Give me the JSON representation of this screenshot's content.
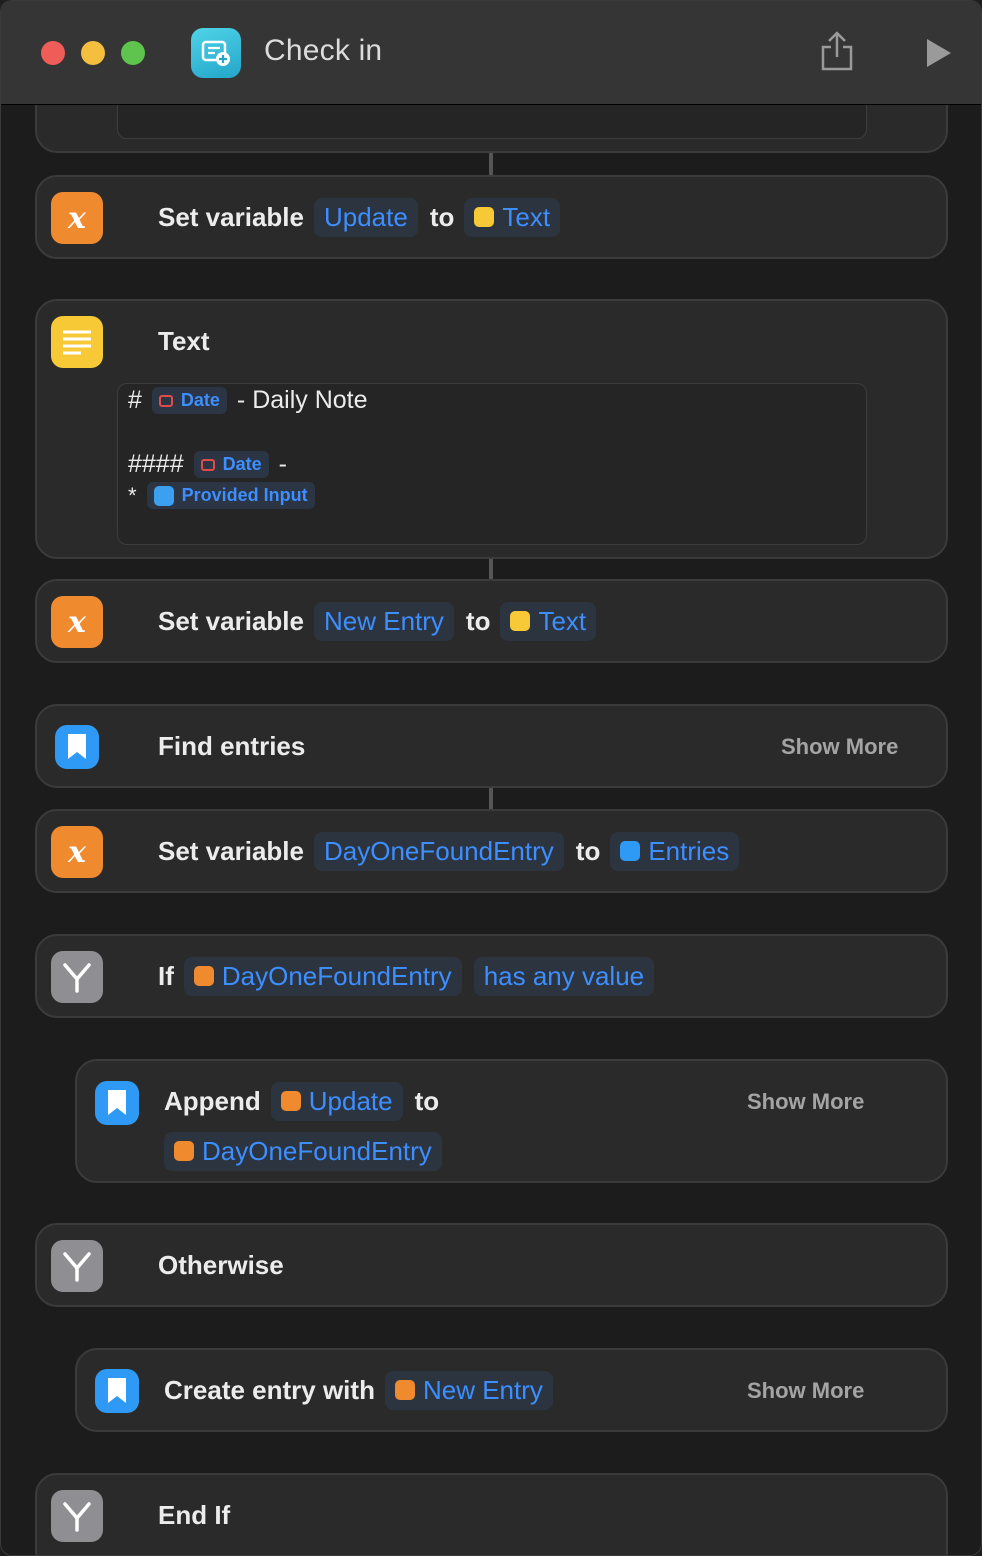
{
  "window": {
    "title": "Check in",
    "icon": "shortcuts-app-icon",
    "share_icon": "share-icon",
    "run_icon": "play-icon"
  },
  "actions": [
    {
      "type": "set_variable",
      "label": "Set variable",
      "variable": "Update",
      "to": "to",
      "value": "Text",
      "value_icon": "text-icon"
    },
    {
      "type": "text",
      "label": "Text",
      "lines": [
        {
          "prefix": "#",
          "token": "Date",
          "suffix": "- Daily Note"
        },
        {
          "prefix": "####",
          "token": "Date",
          "suffix": "-"
        },
        {
          "prefix": "*",
          "token": "Provided Input",
          "suffix": ""
        }
      ]
    },
    {
      "type": "set_variable",
      "label": "Set variable",
      "variable": "New Entry",
      "to": "to",
      "value": "Text",
      "value_icon": "text-icon"
    },
    {
      "type": "find",
      "label": "Find entries",
      "show_more": "Show More"
    },
    {
      "type": "set_variable",
      "label": "Set variable",
      "variable": "DayOneFoundEntry",
      "to": "to",
      "value": "Entries",
      "value_icon": "dayone-icon"
    },
    {
      "type": "if",
      "label": "If",
      "variable": "DayOneFoundEntry",
      "condition": "has any value"
    },
    {
      "type": "append",
      "label": "Append",
      "variable": "Update",
      "to": "to",
      "target": "DayOneFoundEntry",
      "show_more": "Show More"
    },
    {
      "type": "otherwise",
      "label": "Otherwise"
    },
    {
      "type": "create",
      "label": "Create entry with",
      "variable": "New Entry",
      "show_more": "Show More"
    },
    {
      "type": "end_if",
      "label": "End If"
    }
  ]
}
